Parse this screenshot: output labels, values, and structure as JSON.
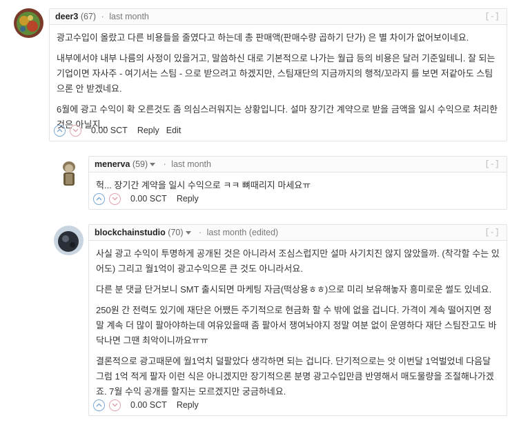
{
  "comments": [
    {
      "author": "deer3",
      "reputation": "(67)",
      "time": "last month",
      "collapse": "[-]",
      "paragraphs": [
        "광고수입이 올랐고 다른 비용들을 줄였다고 하는데 총 판매액(판매수량 곱하기 단가) 은 별 차이가 없어보이네요.",
        "내부에서야 내부 나름의 사정이 있을거고, 말씀하신 대로 기본적으로 나가는 월급 등의 비용은 달러 기준일테니. 잘 되는 기업이면 자사주 - 여기서는 스팀 - 으로 받으려고 하겠지만, 스팀재단의 지금까지의 행적/꼬라지 를 보면 저같아도 스팀으론 안 받겠네요.",
        "6월에 광고 수익이 확 오른것도 좀 의심스러워지는 상황입니다. 설마 장기간 계약으로 받을 금액을 일시 수익으로 처리한 것은 아닐지..."
      ],
      "payout": "0.00 SCT",
      "reply": "Reply",
      "edit": "Edit"
    },
    {
      "author": "menerva",
      "reputation": "(59)",
      "time": "last month",
      "collapse": "[-]",
      "paragraphs": [
        "헉... 장기간 계약을 일시 수익으로 ㅋㅋ 뼈때리지 마세요ㅠ"
      ],
      "payout": "0.00 SCT",
      "reply": "Reply"
    },
    {
      "author": "blockchainstudio",
      "reputation": "(70)",
      "time": "last month (edited)",
      "collapse": "[-]",
      "paragraphs": [
        "사실 광고 수익이 투명하게 공개된 것은 아니라서 조심스럽지만 설마 사기치진 않지 않았을까. (착각할 수는 있어도) 그리고 월1억이 광고수익으론 큰 것도 아니라서요.",
        "다른 분 댓글 단거보니 SMT 출시되면 마케팅 자금(떡상용ㅎㅎ)으로 미리 보유해놓자 흥미로운 썰도 있네요.",
        "250원 간 전력도 있기에 재단은 어쨌든 주기적으로 현금화 할 수 밖에 없을 겁니다. 가격이 계속 떨어지면 정말 계속 더 많이 팔아야하는데 여유있을때 좀 팔아서 쟁여놔야지 정말 여분 없이 운영하다 재단 스팀잔고도 바닥나면 그땐 최악이니까요ㅠㅠ",
        "결론적으로 광고때문에 월1억치 덜팔았다 생각하면 되는 겁니다. 단기적으로는 앗 이번달 1억벌었네 다음달 그럼 1억 적게 팔자 이런 식은 아니겠지만 장기적으론 분명 광고수입만큼 반영해서 매도물량을 조절해나가겠죠. 7월 수익 공개를 할지는 모르겠지만 궁금하네요."
      ],
      "payout": "0.00 SCT",
      "reply": "Reply"
    }
  ],
  "colors": {
    "upvote": "#7aa8d6",
    "downvote": "#e0a3ab",
    "border": "#e3e3e3"
  },
  "icons": [
    "upvote-chevron-icon",
    "downvote-chevron-icon",
    "dropdown-caret-icon"
  ]
}
